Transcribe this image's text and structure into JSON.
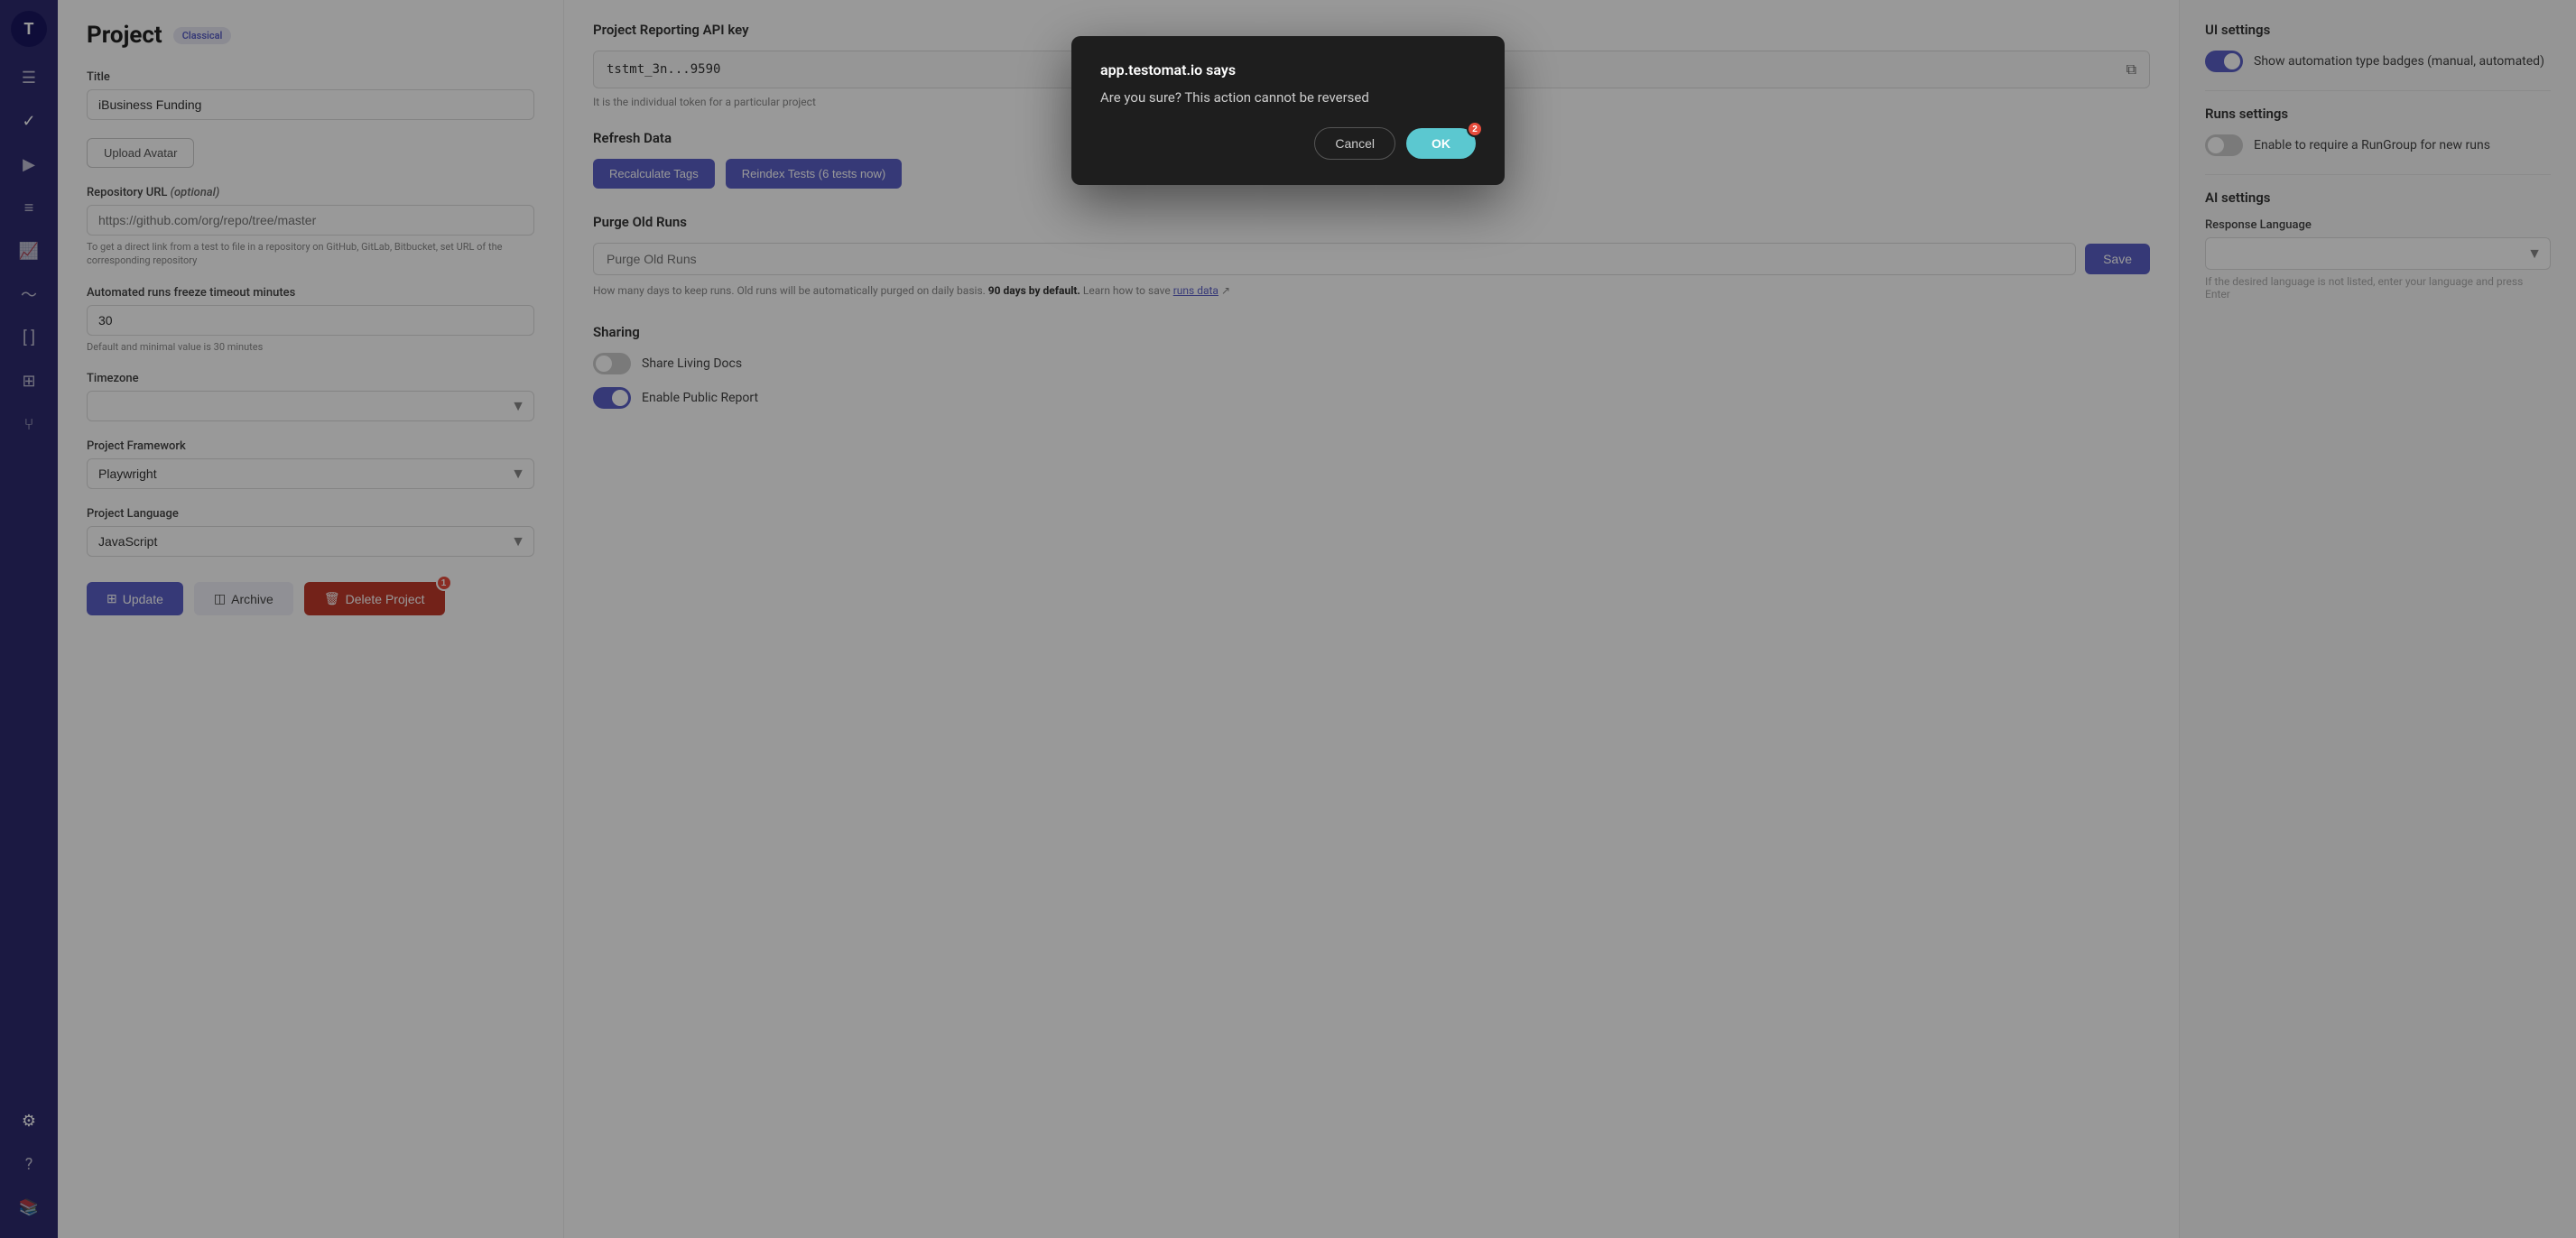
{
  "sidebar": {
    "logo_text": "T",
    "items": [
      {
        "name": "menu",
        "icon": "☰",
        "active": false
      },
      {
        "name": "check",
        "icon": "✓",
        "active": false
      },
      {
        "name": "play",
        "icon": "▶",
        "active": false
      },
      {
        "name": "list",
        "icon": "≡",
        "active": false
      },
      {
        "name": "chart",
        "icon": "📈",
        "active": false
      },
      {
        "name": "pulse",
        "icon": "∿",
        "active": false
      },
      {
        "name": "brackets",
        "icon": "[]",
        "active": false
      },
      {
        "name": "table",
        "icon": "⊞",
        "active": false
      },
      {
        "name": "fork",
        "icon": "⑂",
        "active": false
      },
      {
        "name": "settings",
        "icon": "⚙",
        "active": true
      },
      {
        "name": "help",
        "icon": "?",
        "active": false
      },
      {
        "name": "library",
        "icon": "📚",
        "active": false
      }
    ]
  },
  "header": {
    "title": "Project",
    "badge": "Classical"
  },
  "form": {
    "title_label": "Title",
    "title_value": "iBusiness Funding",
    "upload_avatar_label": "Upload Avatar",
    "repo_url_label": "Repository URL",
    "repo_url_placeholder": "https://github.com/org/repo/tree/master",
    "repo_url_hint": "To get a direct link from a test to file in a repository on GitHub, GitLab, Bitbucket, set URL of the corresponding repository",
    "freeze_timeout_label": "Automated runs freeze timeout minutes",
    "freeze_timeout_value": "30",
    "freeze_timeout_hint": "Default and minimal value is 30 minutes",
    "timezone_label": "Timezone",
    "timezone_value": "",
    "framework_label": "Project Framework",
    "framework_value": "Playwright",
    "language_label": "Project Language",
    "language_value": "JavaScript",
    "update_label": "Update",
    "archive_label": "Archive",
    "delete_label": "Delete Project",
    "delete_badge": "1"
  },
  "reporting": {
    "api_key_section": "Project Reporting API key",
    "api_key_value": "tstmt_3n...9590",
    "api_key_hint": "It is the individual token for a particular project",
    "refresh_section": "Refresh Data",
    "recalculate_label": "Recalculate Tags",
    "reindex_label": "Reindex Tests (6 tests now)",
    "purge_section": "Purge Old Runs",
    "purge_placeholder": "Purge Old Runs",
    "purge_save_label": "Save",
    "purge_hint_1": "How many days to keep runs. Old runs will be automatically purged on daily basis.",
    "purge_hint_bold": "90 days by default.",
    "purge_hint_2": "Learn how to save",
    "purge_link_text": "runs data",
    "sharing_section": "Sharing",
    "share_living_docs_label": "Share Living Docs",
    "share_living_docs_on": false,
    "enable_public_report_label": "Enable Public Report",
    "enable_public_report_on": true
  },
  "settings_panel": {
    "ui_settings_title": "UI settings",
    "show_badges_label": "Show automation type badges (manual, automated)",
    "show_badges_on": true,
    "runs_settings_title": "Runs settings",
    "require_rungroup_label": "Enable to require a RunGroup for new runs",
    "require_rungroup_on": false,
    "ai_settings_title": "AI settings",
    "response_language_label": "Response Language",
    "response_language_value": "",
    "response_language_hint": "If the desired language is not listed, enter your language and press Enter"
  },
  "dialog": {
    "origin": "app.testomat.io says",
    "message": "Are you sure? This action cannot be reversed",
    "cancel_label": "Cancel",
    "ok_label": "OK",
    "ok_badge": "2"
  }
}
